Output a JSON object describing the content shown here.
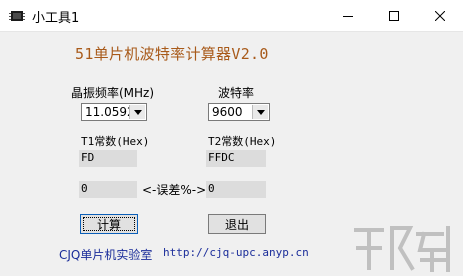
{
  "window": {
    "title": "小工具1"
  },
  "app": {
    "heading": "51单片机波特率计算器V2.0"
  },
  "crystal": {
    "label": "晶振频率(MHz)",
    "value": "11.0592"
  },
  "baud": {
    "label": "波特率",
    "value": "9600"
  },
  "t1": {
    "label": "T1常数(Hex)",
    "value": "FD"
  },
  "t2": {
    "label": "T2常数(Hex)",
    "value": "FFDC"
  },
  "error": {
    "label": "<-误差%->",
    "left_value": "0",
    "right_value": "0"
  },
  "buttons": {
    "calculate": "计算",
    "exit": "退出"
  },
  "footer": {
    "lab_name": "CJQ单片机实验室",
    "url": "http://cjq-upc.anyp.cn"
  },
  "colors": {
    "heading": "#a85a1a",
    "footer_text": "#1b2d9a"
  }
}
